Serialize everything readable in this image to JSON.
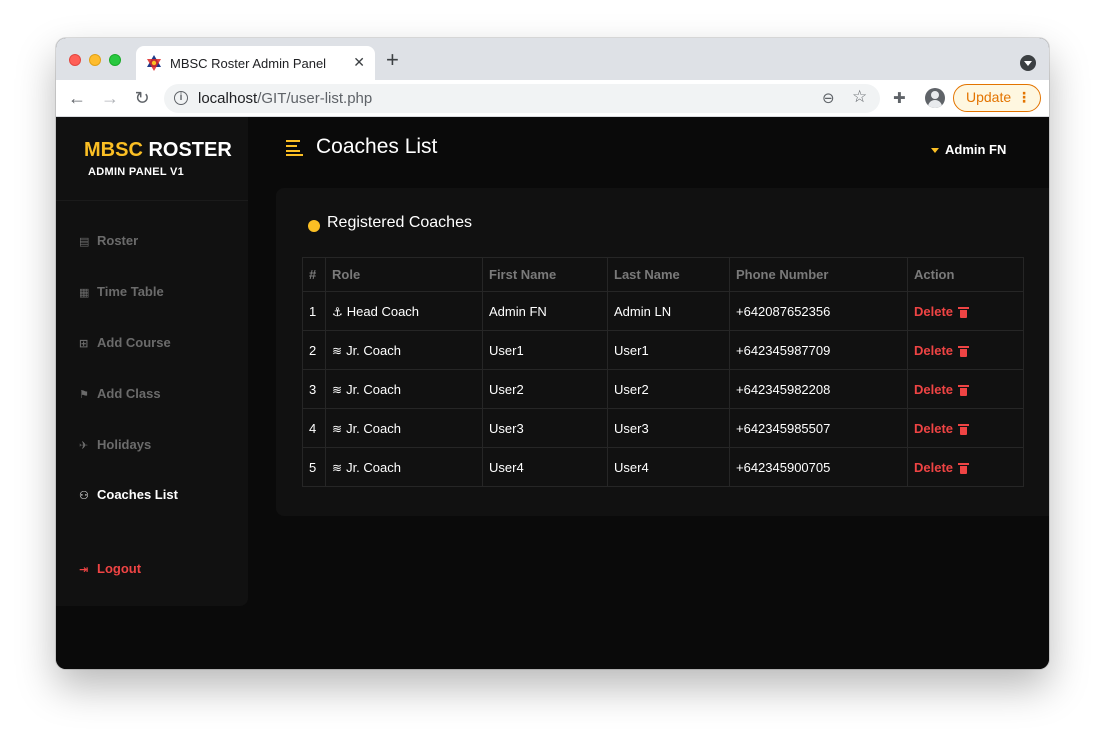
{
  "browser": {
    "tab_title": "MBSC Roster Admin Panel",
    "url_host": "localhost",
    "url_path": "/GIT/user-list.php",
    "update_label": "Update"
  },
  "sidebar": {
    "brand_part1": "MBSC",
    "brand_part2": "ROSTER",
    "subtitle": "ADMIN PANEL V1",
    "items": [
      {
        "label": "Roster",
        "icon": "clipboard-icon"
      },
      {
        "label": "Time Table",
        "icon": "calendar-icon"
      },
      {
        "label": "Add Course",
        "icon": "calendar-plus-icon"
      },
      {
        "label": "Add Class",
        "icon": "flag-icon"
      },
      {
        "label": "Holidays",
        "icon": "plane-icon"
      },
      {
        "label": "Coaches List",
        "icon": "users-icon"
      }
    ],
    "logout_label": "Logout"
  },
  "header": {
    "title": "Coaches List",
    "user_name": "Admin FN"
  },
  "card": {
    "title": "Registered Coaches"
  },
  "table": {
    "columns": [
      "#",
      "Role",
      "First Name",
      "Last Name",
      "Phone Number",
      "Action"
    ],
    "rows": [
      {
        "num": "1",
        "role": "Head Coach",
        "role_icon": "anchor-icon",
        "first": "Admin FN",
        "last": "Admin LN",
        "phone": "+642087652356",
        "action": "Delete"
      },
      {
        "num": "2",
        "role": "Jr. Coach",
        "role_icon": "wind-icon",
        "first": "User1",
        "last": "User1",
        "phone": "+642345987709",
        "action": "Delete"
      },
      {
        "num": "3",
        "role": "Jr. Coach",
        "role_icon": "wind-icon",
        "first": "User2",
        "last": "User2",
        "phone": "+642345982208",
        "action": "Delete"
      },
      {
        "num": "4",
        "role": "Jr. Coach",
        "role_icon": "wind-icon",
        "first": "User3",
        "last": "User3",
        "phone": "+642345985507",
        "action": "Delete"
      },
      {
        "num": "5",
        "role": "Jr. Coach",
        "role_icon": "wind-icon",
        "first": "User4",
        "last": "User4",
        "phone": "+642345900705",
        "action": "Delete"
      }
    ]
  },
  "colors": {
    "accent": "#fbbf24",
    "danger": "#ef4444",
    "background": "#0a0a0a",
    "panel": "#111111"
  }
}
